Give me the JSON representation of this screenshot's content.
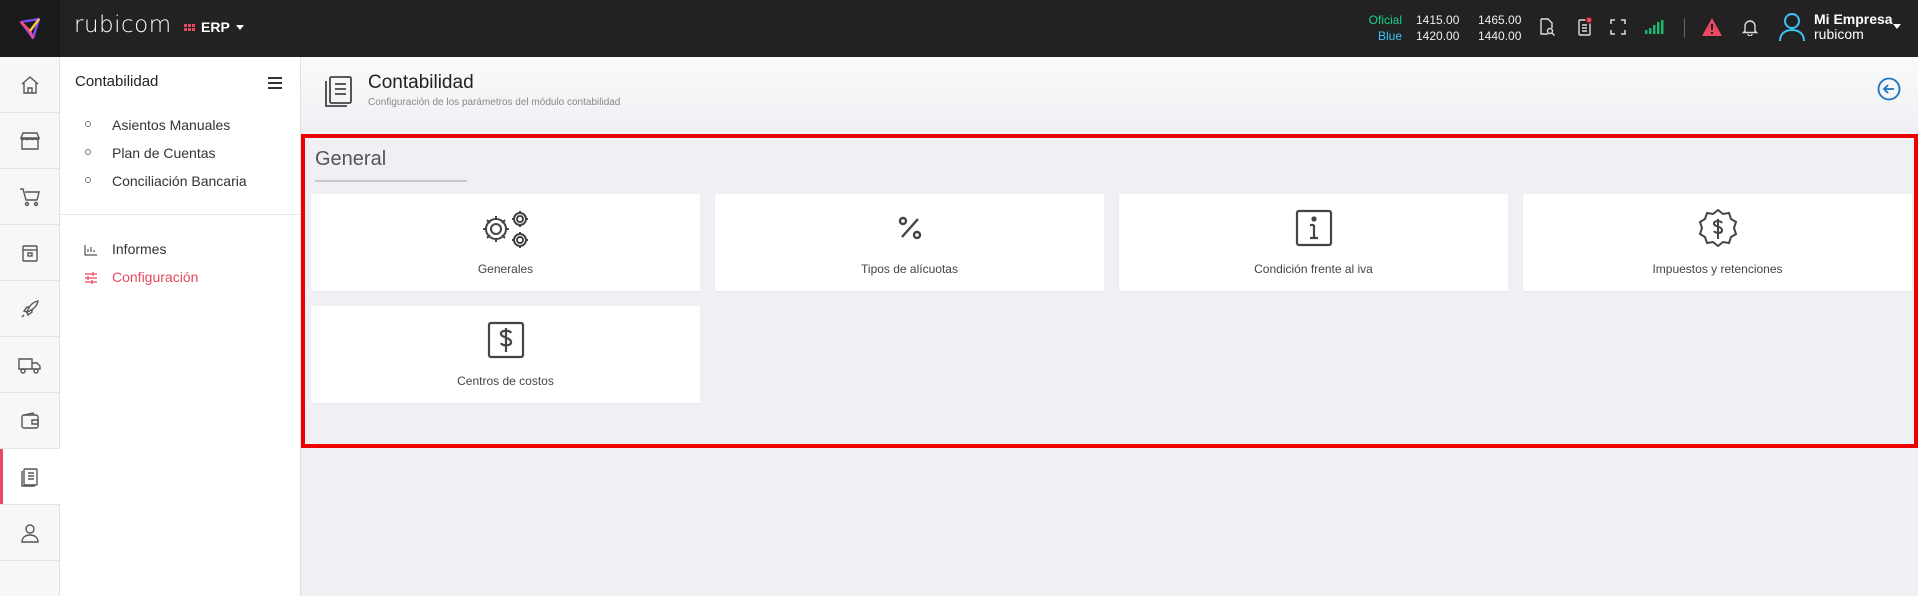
{
  "topbar": {
    "brand": "rubicom",
    "module": "ERP",
    "rates": [
      {
        "label": "Oficial",
        "buy": "1415.00",
        "sell": "1465.00"
      },
      {
        "label": "Blue",
        "buy": "1420.00",
        "sell": "1440.00"
      }
    ],
    "user": {
      "name": "Mi Empresa",
      "company": "rubicom"
    }
  },
  "rail": [
    "home-icon",
    "store-icon",
    "cart-icon",
    "box-icon",
    "rocket-icon",
    "truck-icon",
    "wallet-icon",
    "book-icon",
    "user-icon"
  ],
  "submenu": {
    "title": "Contabilidad",
    "items": [
      "Asientos Manuales",
      "Plan de Cuentas",
      "Conciliación Bancaria"
    ],
    "reports": "Informes",
    "config": "Configuración"
  },
  "page": {
    "title": "Contabilidad",
    "subtitle": "Configuración de los parámetros del módulo contabilidad"
  },
  "section": {
    "title": "General",
    "cards": [
      {
        "label": "Generales",
        "icon": "gears-icon"
      },
      {
        "label": "Tipos de alícuotas",
        "icon": "percent-icon"
      },
      {
        "label": "Condición frente al iva",
        "icon": "info-icon"
      },
      {
        "label": "Impuestos y retenciones",
        "icon": "dollar-badge-icon"
      },
      {
        "label": "Centros de costos",
        "icon": "dollar-box-icon"
      }
    ]
  },
  "colors": {
    "accent": "#e84860",
    "oficial": "#1bd18b",
    "blue": "#3ec3f5",
    "highlight": "#ee0000",
    "link": "#1e73be"
  }
}
